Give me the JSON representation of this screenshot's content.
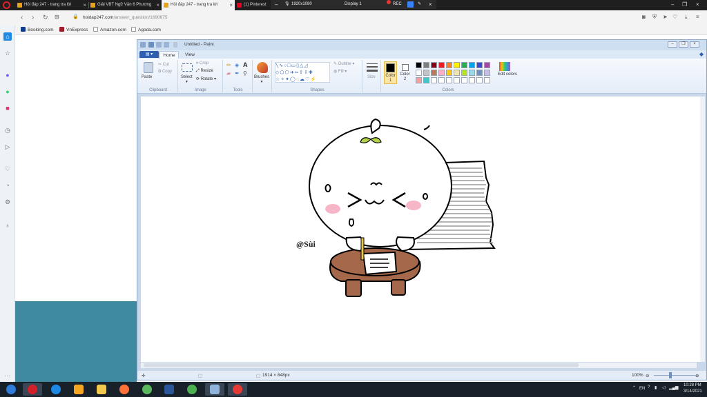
{
  "browser": {
    "tabs": [
      {
        "label": "Hỏi đáp 247 - trang tra lời",
        "active": false,
        "color": "#e6a21c"
      },
      {
        "label": "Giải VBT Ngữ Văn 6 Phương",
        "active": false,
        "color": "#e6a21c"
      },
      {
        "label": "Hỏi đáp 247 - trang tra lời",
        "active": true,
        "color": "#e6a21c"
      },
      {
        "label": "(1) Pinterest",
        "active": false,
        "color": "#e60023"
      }
    ],
    "recorder": {
      "resolution": "1920x1080",
      "display": "Display 1",
      "rec_label": "REC"
    },
    "url": {
      "host": "hoidap247.com",
      "path": "/answer_question/1690675"
    },
    "bookmarks": [
      {
        "label": "Booking.com",
        "color": "#0d3c8a"
      },
      {
        "label": "VnExpress",
        "color": "#a01c28"
      },
      {
        "label": "Amazon.com",
        "color": "#222222"
      },
      {
        "label": "Agoda.com",
        "color": "#555555"
      }
    ]
  },
  "paint": {
    "title": "Untitled - Paint",
    "file_button": "",
    "tabs": [
      "Home",
      "View"
    ],
    "clipboard": {
      "paste": "Paste",
      "cut": "Cut",
      "copy": "Copy",
      "label": "Clipboard"
    },
    "image": {
      "select": "Select",
      "crop": "Crop",
      "resize": "Resize",
      "rotate": "Rotate",
      "label": "Image"
    },
    "tools": {
      "label": "Tools"
    },
    "brushes": {
      "label": "Brushes"
    },
    "shapes": {
      "outline": "Outline",
      "fill": "Fill",
      "label": "Shapes"
    },
    "size": {
      "label": "Size"
    },
    "colors": {
      "color1": "Color 1",
      "color2": "Color 2",
      "edit": "Edit colors",
      "label": "Colors",
      "color1_value": "#000000",
      "color2_value": "#ffffff",
      "palette": [
        "#000000",
        "#7f7f7f",
        "#880015",
        "#ed1c24",
        "#ff7f27",
        "#fff200",
        "#22b14c",
        "#00a2e8",
        "#3f48cc",
        "#a349a4",
        "#ffffff",
        "#c3c3c3",
        "#b97a57",
        "#ffaec9",
        "#ffc90e",
        "#efe4b0",
        "#b5e61d",
        "#99d9ea",
        "#7092be",
        "#c8bfe7",
        "#f8a0a0",
        "#3fc7c7",
        "#ffffff",
        "#ffffff",
        "#ffffff",
        "#ffffff",
        "#ffffff",
        "#ffffff",
        "#ffffff",
        "#ffffff"
      ]
    },
    "canvas": {
      "signature": "@Sùi"
    },
    "status": {
      "dimensions": "1914 × 848px",
      "zoom": "100%"
    }
  },
  "taskbar": {
    "apps": [
      {
        "name": "start",
        "color": "#2f7bd8"
      },
      {
        "name": "opera",
        "color": "#d32029"
      },
      {
        "name": "internet-explorer",
        "color": "#1e88e5"
      },
      {
        "name": "media-player",
        "color": "#f4a623"
      },
      {
        "name": "file-explorer",
        "color": "#f2c94c"
      },
      {
        "name": "firefox",
        "color": "#ff7139"
      },
      {
        "name": "green-app",
        "color": "#5cb85c"
      },
      {
        "name": "word",
        "color": "#2b579a"
      },
      {
        "name": "chrome",
        "color": "#4caf50"
      },
      {
        "name": "paint",
        "color": "#8fb3d9"
      },
      {
        "name": "recorder",
        "color": "#e53935"
      }
    ],
    "language": "EN",
    "time": "10:28 PM",
    "date": "3/14/2021"
  }
}
